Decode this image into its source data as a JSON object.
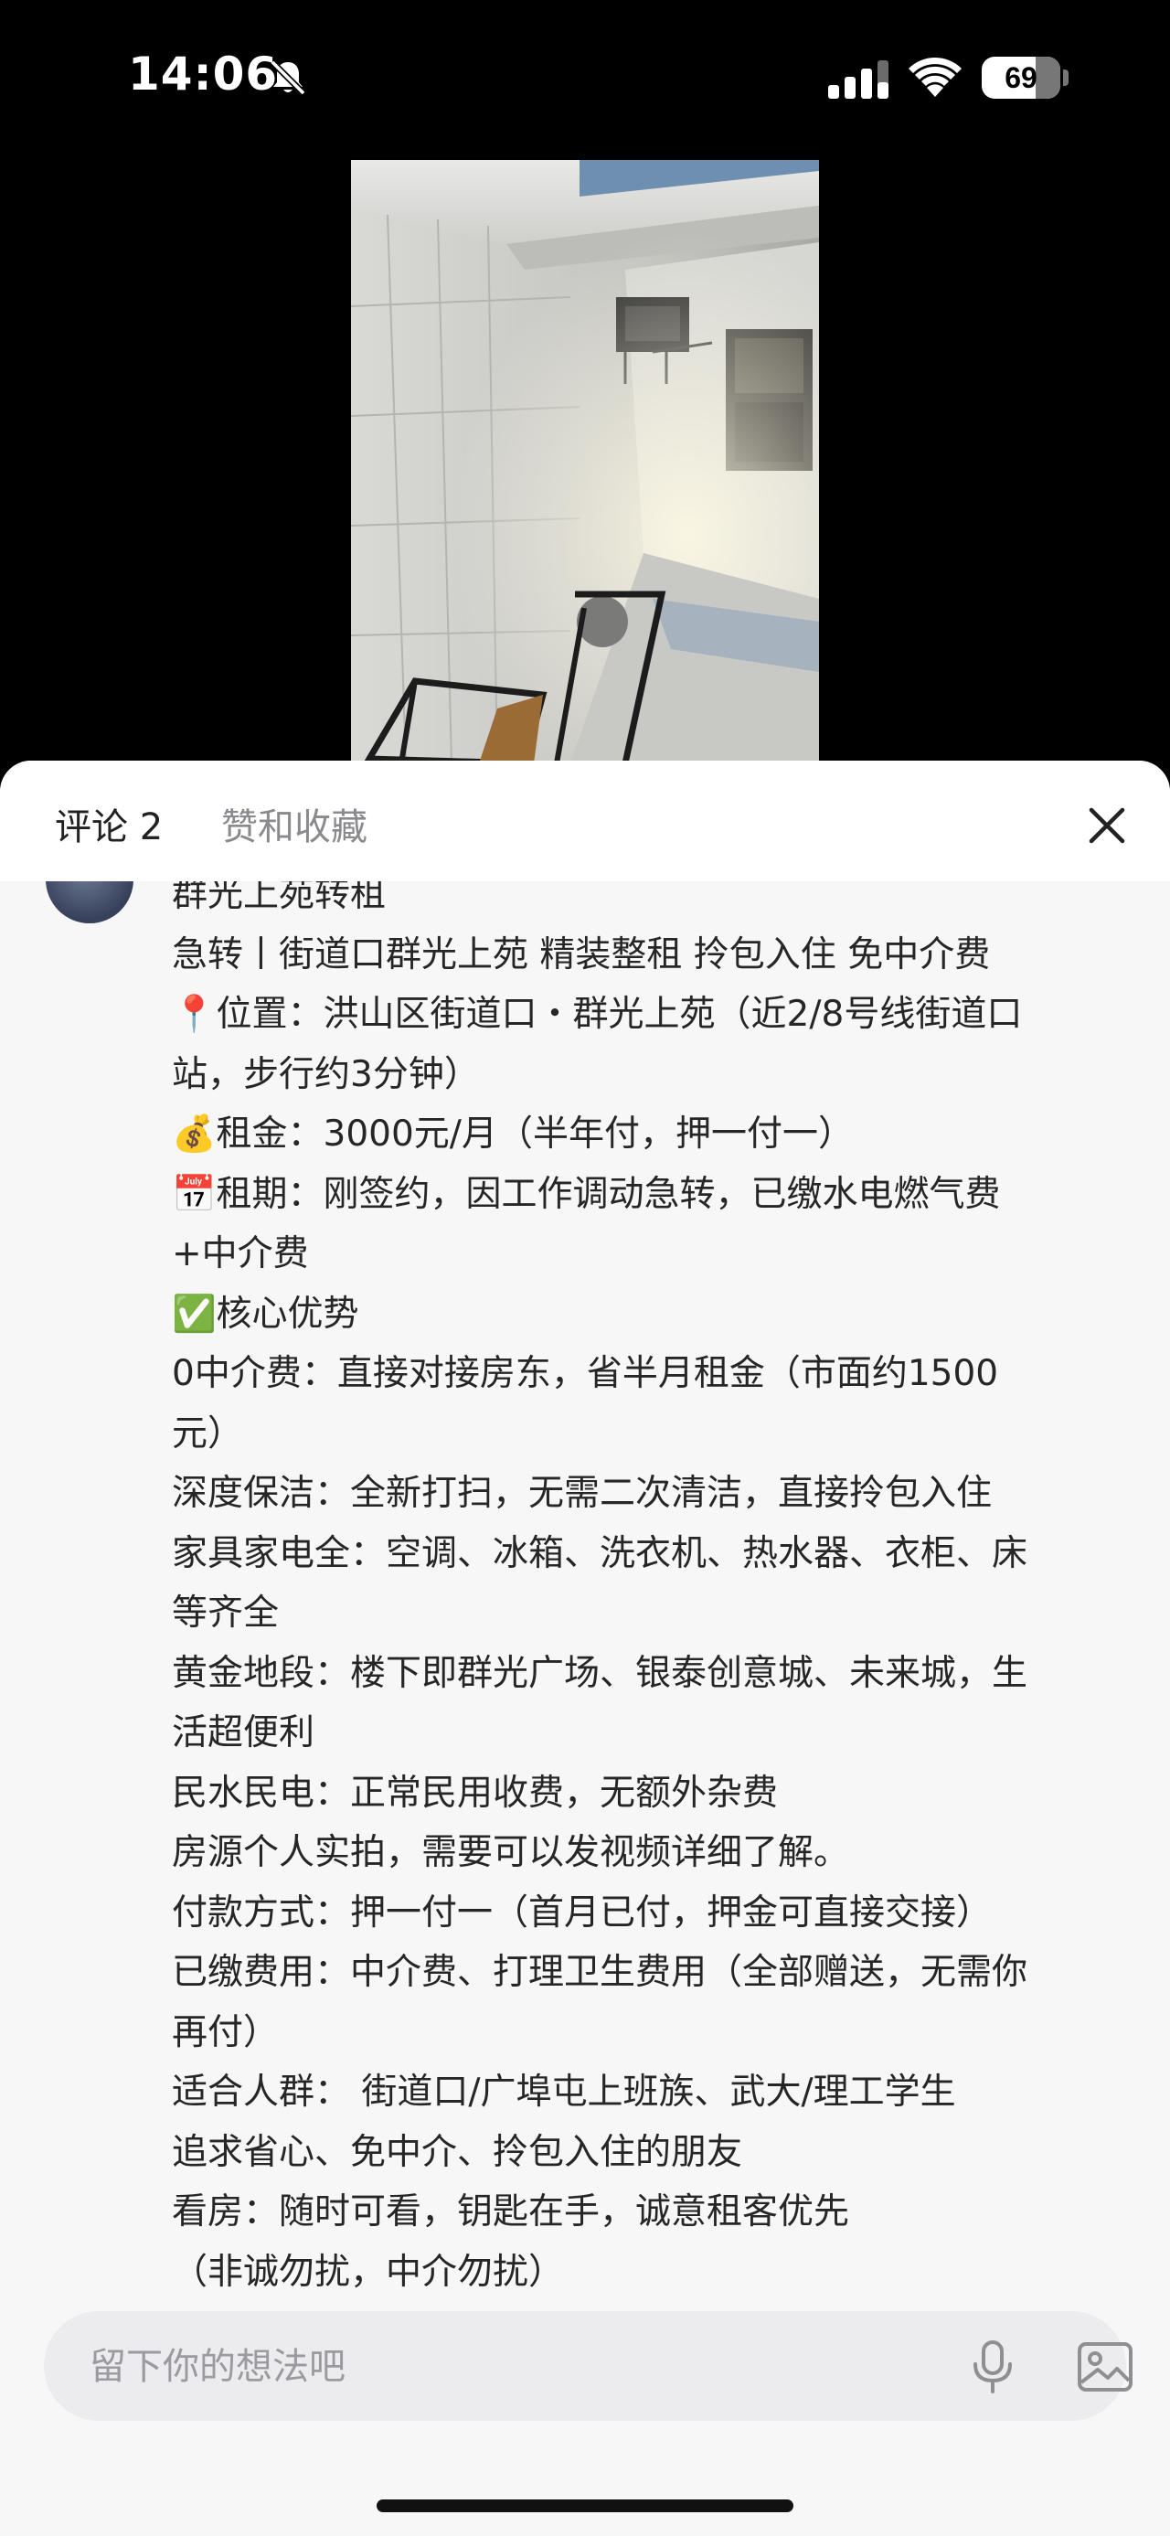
{
  "status_bar": {
    "time": "14:06",
    "battery_level": "69",
    "battery_fraction": 0.69,
    "icons": [
      "bell-slash-icon",
      "signal-bars-icon",
      "wifi-icon",
      "battery-icon"
    ]
  },
  "photo": {
    "icon": "apartment-room-photo"
  },
  "sheet": {
    "tabs": [
      {
        "label": "评论 2",
        "active": true
      },
      {
        "label": "赞和收藏",
        "active": false
      }
    ],
    "close_icon": "close-icon"
  },
  "comment": {
    "lines": [
      "群光上苑转租",
      "急转丨街道口群光上苑 精装整租 拎包入住 免中介费",
      "📍位置：洪山区街道口・群光上苑（近2/8号线街道口",
      "站，步行约3分钟）",
      "💰租金：3000元/月（半年付，押一付一）",
      "📅租期：刚签约，因工作调动急转，已缴水电燃气费",
      "+中介费",
      "✅核心优势",
      "0中介费：直接对接房东，省半月租金（市面约1500",
      "元）",
      "深度保洁：全新打扫，无需二次清洁，直接拎包入住",
      "家具家电全：空调、冰箱、洗衣机、热水器、衣柜、床",
      "等齐全",
      "黄金地段：楼下即群光广场、银泰创意城、未来城，生",
      "活超便利",
      "民水民电：正常民用收费，无额外杂费",
      "房源个人实拍，需要可以发视频详细了解。",
      "付款方式：押一付一（首月已付，押金可直接交接）",
      "已缴费用：中介费、打理卫生费用（全部赠送，无需你",
      "再付）",
      "适合人群： 街道口/广埠屯上班族、武大/理工学生",
      "追求省心、免中介、拎包入住的朋友",
      "看房：随时可看，钥匙在手，诚意租客优先",
      "（非诚勿扰，中介勿扰）"
    ]
  },
  "input": {
    "placeholder": "留下你的想法吧",
    "value": "",
    "icons": [
      "microphone-icon",
      "image-icon"
    ]
  },
  "colors": {
    "sheet_background": "#f7f7f8",
    "header_background": "#ffffff",
    "text_primary": "#262626",
    "text_secondary": "#8a8a8e",
    "input_background": "#ececee"
  }
}
